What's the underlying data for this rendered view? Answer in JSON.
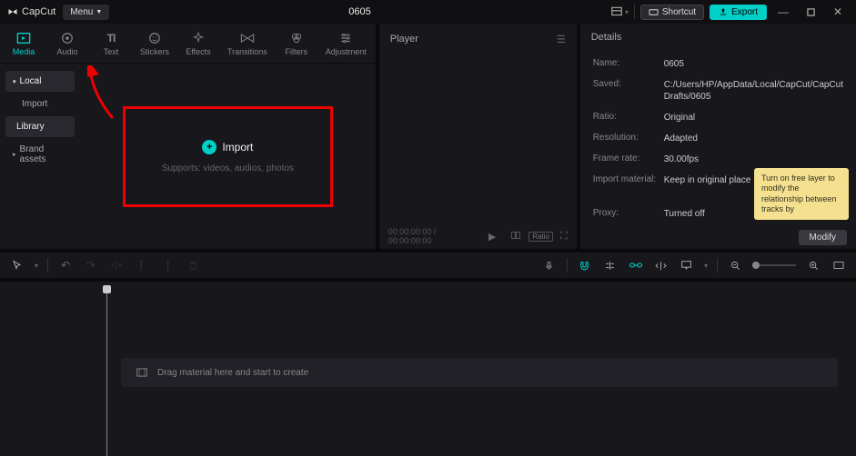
{
  "app": {
    "name": "CapCut",
    "project_title": "0605"
  },
  "titlebar": {
    "menu_label": "Menu",
    "shortcut_label": "Shortcut",
    "export_label": "Export"
  },
  "tool_tabs": [
    {
      "id": "media",
      "label": "Media"
    },
    {
      "id": "audio",
      "label": "Audio"
    },
    {
      "id": "text",
      "label": "Text"
    },
    {
      "id": "stickers",
      "label": "Stickers"
    },
    {
      "id": "effects",
      "label": "Effects"
    },
    {
      "id": "transitions",
      "label": "Transitions"
    },
    {
      "id": "filters",
      "label": "Filters"
    },
    {
      "id": "adjustment",
      "label": "Adjustment"
    }
  ],
  "left_nav": {
    "local": "Local",
    "import": "Import",
    "library": "Library",
    "brand": "Brand assets"
  },
  "import_zone": {
    "button": "Import",
    "subtitle": "Supports: videos, audios, photos"
  },
  "player": {
    "title": "Player",
    "timecode": "00:00:00:00 / 00:00:00:00",
    "ratio_chip": "Ratio"
  },
  "details": {
    "title": "Details",
    "rows": {
      "name_l": "Name:",
      "name_v": "0605",
      "saved_l": "Saved:",
      "saved_v": "C:/Users/HP/AppData/Local/CapCut/CapCut Drafts/0605",
      "ratio_l": "Ratio:",
      "ratio_v": "Original",
      "res_l": "Resolution:",
      "res_v": "Adapted",
      "fps_l": "Frame rate:",
      "fps_v": "30.00fps",
      "impmat_l": "Import material:",
      "impmat_v": "Keep in original place",
      "proxy_l": "Proxy:",
      "proxy_v": "Turned off"
    },
    "tooltip": "Turn on free layer to modify the relationship between tracks by",
    "modify": "Modify"
  },
  "timeline": {
    "drag_hint": "Drag material here and start to create"
  }
}
